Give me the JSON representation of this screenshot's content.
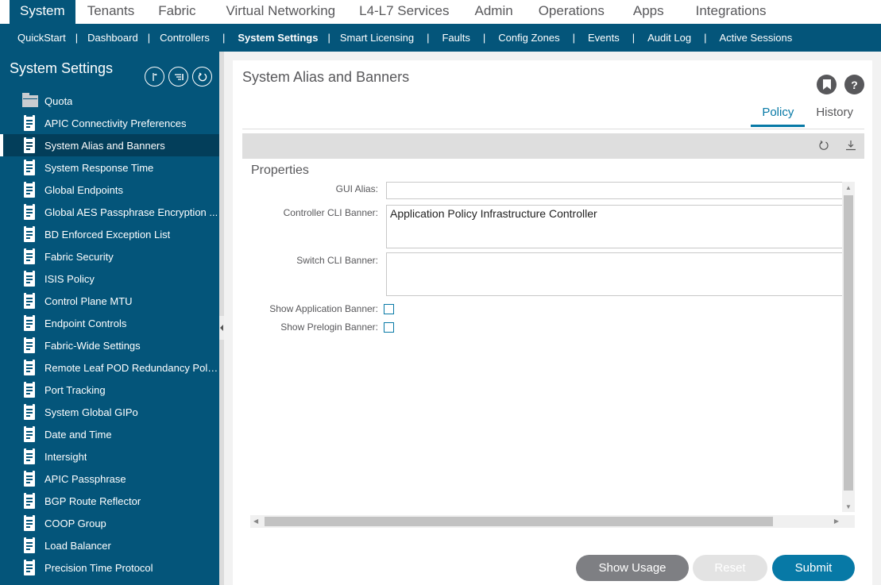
{
  "top_nav": {
    "tabs": [
      {
        "label": "System",
        "active": true
      },
      {
        "label": "Tenants"
      },
      {
        "label": "Fabric"
      },
      {
        "label": "Virtual Networking"
      },
      {
        "label": "L4-L7 Services"
      },
      {
        "label": "Admin"
      },
      {
        "label": "Operations"
      },
      {
        "label": "Apps"
      },
      {
        "label": "Integrations"
      }
    ]
  },
  "sub_nav": {
    "items": [
      {
        "label": "QuickStart"
      },
      {
        "label": "Dashboard"
      },
      {
        "label": "Controllers"
      },
      {
        "label": "System Settings",
        "active": true
      },
      {
        "label": "Smart Licensing"
      },
      {
        "label": "Faults"
      },
      {
        "label": "Config Zones"
      },
      {
        "label": "Events"
      },
      {
        "label": "Audit Log"
      },
      {
        "label": "Active Sessions"
      }
    ]
  },
  "sidebar": {
    "title": "System Settings",
    "tool_icons": [
      "collapse-all-icon",
      "filter-icon",
      "refresh-icon"
    ],
    "items": [
      {
        "label": "Quota",
        "icon": "folder-icon"
      },
      {
        "label": "APIC Connectivity Preferences",
        "icon": "document-icon"
      },
      {
        "label": "System Alias and Banners",
        "icon": "document-icon",
        "selected": true
      },
      {
        "label": "System Response Time",
        "icon": "document-icon"
      },
      {
        "label": "Global Endpoints",
        "icon": "document-icon"
      },
      {
        "label": "Global AES Passphrase Encryption ...",
        "icon": "document-icon"
      },
      {
        "label": "BD Enforced Exception List",
        "icon": "document-icon"
      },
      {
        "label": "Fabric Security",
        "icon": "document-icon"
      },
      {
        "label": "ISIS Policy",
        "icon": "document-icon"
      },
      {
        "label": "Control Plane MTU",
        "icon": "document-icon"
      },
      {
        "label": "Endpoint Controls",
        "icon": "document-icon"
      },
      {
        "label": "Fabric-Wide Settings",
        "icon": "document-icon"
      },
      {
        "label": "Remote Leaf POD Redundancy Policy",
        "icon": "document-icon"
      },
      {
        "label": "Port Tracking",
        "icon": "document-icon"
      },
      {
        "label": "System Global GIPo",
        "icon": "document-icon"
      },
      {
        "label": "Date and Time",
        "icon": "document-icon"
      },
      {
        "label": "Intersight",
        "icon": "document-icon"
      },
      {
        "label": "APIC Passphrase",
        "icon": "document-icon"
      },
      {
        "label": "BGP Route Reflector",
        "icon": "document-icon"
      },
      {
        "label": "COOP Group",
        "icon": "document-icon"
      },
      {
        "label": "Load Balancer",
        "icon": "document-icon"
      },
      {
        "label": "Precision Time Protocol",
        "icon": "document-icon"
      }
    ]
  },
  "panel": {
    "title": "System Alias and Banners",
    "help_glyph": "?",
    "tabs": [
      {
        "label": "Policy",
        "active": true
      },
      {
        "label": "History"
      }
    ],
    "toolbar_icons": [
      "refresh-icon",
      "download-icon"
    ],
    "properties_title": "Properties",
    "fields": {
      "gui_alias": {
        "label": "GUI Alias:",
        "value": ""
      },
      "controller_cli_banner": {
        "label": "Controller CLI Banner:",
        "value": "Application Policy Infrastructure Controller"
      },
      "switch_cli_banner": {
        "label": "Switch CLI Banner:",
        "value": ""
      },
      "show_application_banner": {
        "label": "Show Application Banner:",
        "checked": false
      },
      "show_prelogin_banner": {
        "label": "Show Prelogin Banner:",
        "checked": false
      }
    },
    "buttons": {
      "show_usage": "Show Usage",
      "reset": "Reset",
      "submit": "Submit"
    }
  },
  "colors": {
    "brand": "#04557a",
    "accent": "#0779a6",
    "selected_row": "#033e5a",
    "show_usage_button": "#7e7f83",
    "reset_button_disabled": "#e3e3e3"
  }
}
